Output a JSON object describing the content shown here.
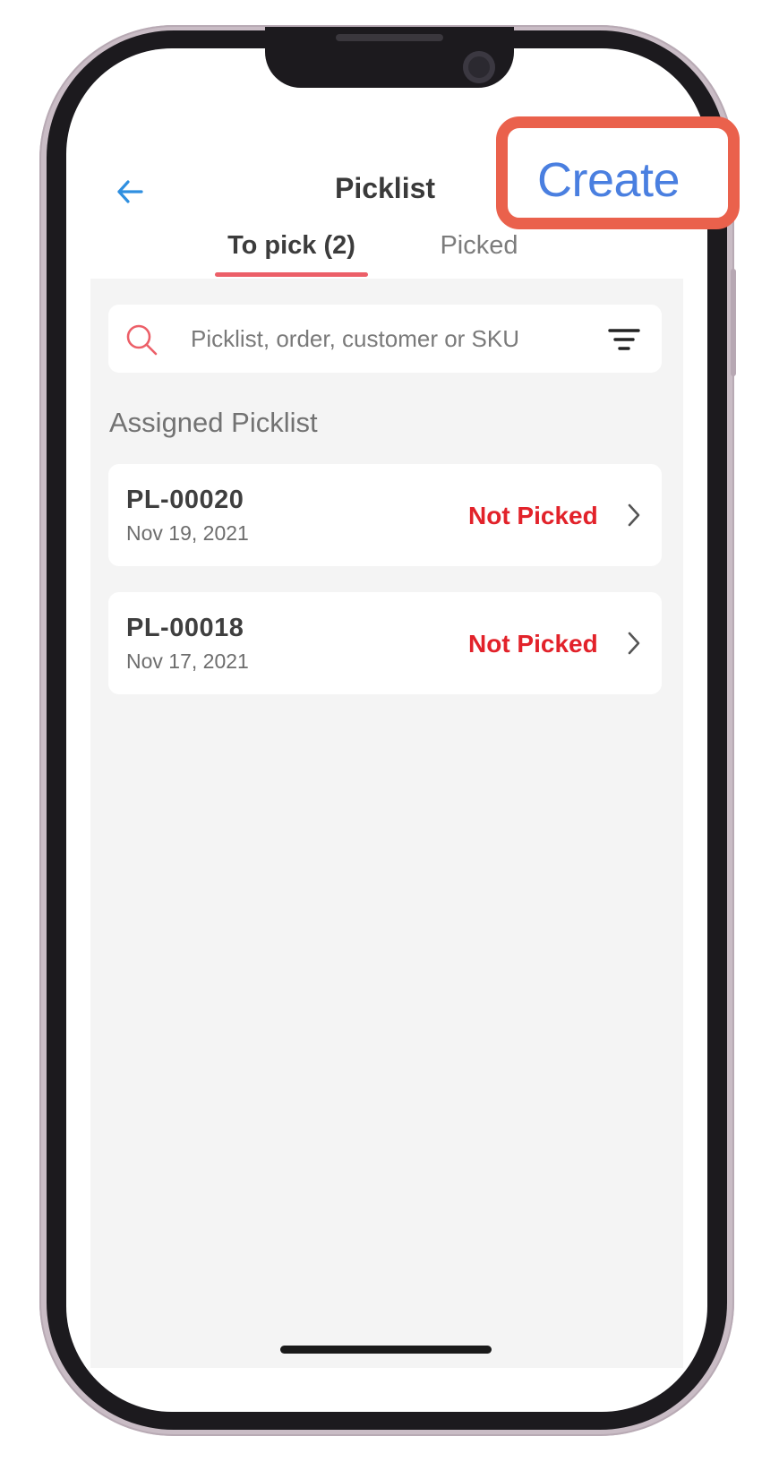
{
  "header": {
    "title": "Picklist",
    "create_label": "Create"
  },
  "tabs": [
    {
      "label": "To pick (2)",
      "active": true
    },
    {
      "label": "Picked",
      "active": false
    }
  ],
  "search": {
    "placeholder": "Picklist, order, customer or SKU",
    "value": ""
  },
  "section": {
    "heading": "Assigned Picklist"
  },
  "picklists": [
    {
      "id": "PL-00020",
      "date": "Nov 19, 2021",
      "status": "Not Picked"
    },
    {
      "id": "PL-00018",
      "date": "Nov 17, 2021",
      "status": "Not Picked"
    }
  ],
  "icons": {
    "back": "arrow-left-icon",
    "search": "search-icon",
    "filter": "filter-icon",
    "chevron": "chevron-right-icon"
  },
  "colors": {
    "accent_blue": "#4a7fe0",
    "back_arrow": "#2f8fe0",
    "tab_underline": "#ec5f68",
    "status_red": "#e2222a",
    "highlight_box": "#ea614c",
    "content_background": "#f4f4f4"
  }
}
